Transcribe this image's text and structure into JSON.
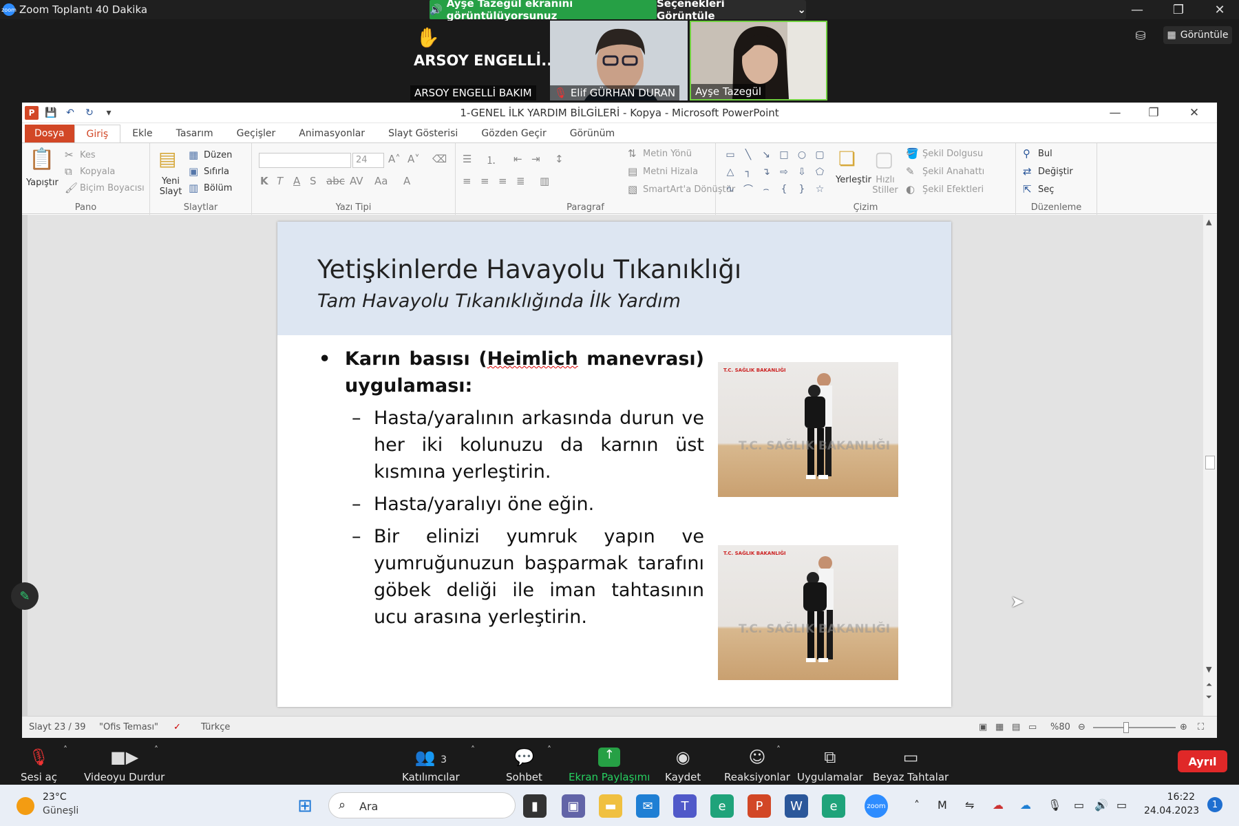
{
  "zoom": {
    "window_title": "Zoom Toplantı 40 Dakika",
    "share_banner": "Ayşe Tazegül ekranını görüntülüyorsunuz",
    "view_options": "Seçenekleri Görüntüle",
    "view_button": "Görüntüle",
    "participants": [
      {
        "name": "ARSOY ENGELLİ BAKIM",
        "display_big": "ARSOY  ENGELLİ..."
      },
      {
        "name": "Elif GÜRHAN DURAN"
      },
      {
        "name": "Ayşe Tazegül"
      }
    ],
    "controls": {
      "unmute": "Sesi aç",
      "stop_video": "Videoyu Durdur",
      "participants": "Katılımcılar",
      "participants_count": "3",
      "chat": "Sohbet",
      "share": "Ekran Paylaşımı",
      "record": "Kaydet",
      "reactions": "Reaksiyonlar",
      "apps": "Uygulamalar",
      "whiteboards": "Beyaz Tahtalar",
      "leave": "Ayrıl"
    },
    "share_color": "#26a045",
    "leave_color": "#e02828"
  },
  "ppt": {
    "title": "1-GENEL İLK YARDIM BİLGİLERİ - Kopya  -  Microsoft PowerPoint",
    "tabs": [
      "Dosya",
      "Giriş",
      "Ekle",
      "Tasarım",
      "Geçişler",
      "Animasyonlar",
      "Slayt Gösterisi",
      "Gözden Geçir",
      "Görünüm"
    ],
    "ribbon": {
      "pano": {
        "label": "Pano",
        "paste": "Yapıştır",
        "cut": "Kes",
        "copy": "Kopyala",
        "format_painter": "Biçim Boyacısı"
      },
      "slaytlar": {
        "label": "Slaytlar",
        "new_slide": "Yeni Slayt",
        "layout": "Düzen",
        "reset": "Sıfırla",
        "section": "Bölüm"
      },
      "yazi_tipi": {
        "label": "Yazı Tipi",
        "font_size": "24"
      },
      "paragraf": {
        "label": "Paragraf",
        "text_direction": "Metin Yönü",
        "align_text": "Metni Hizala",
        "smartart": "SmartArt'a Dönüştür"
      },
      "cizim": {
        "label": "Çizim",
        "arrange": "Yerleştir",
        "quick_styles": "Hızlı Stiller",
        "shape_fill": "Şekil Dolgusu",
        "shape_outline": "Şekil Anahattı",
        "shape_effects": "Şekil Efektleri"
      },
      "duzenleme": {
        "label": "Düzenleme",
        "find": "Bul",
        "replace": "Değiştir",
        "select": "Seç"
      }
    },
    "slide": {
      "title": "Yetişkinlerde Havayolu Tıkanıklığı",
      "subtitle": "Tam Havayolu Tıkanıklığında İlk Yardım",
      "bullet_pre": "Karın basısı (",
      "bullet_mid": "Heimlich",
      "bullet_post": " manevrası) uygulaması:",
      "subbullets": [
        "Hasta/yaralının arkasında durun ve her iki kolunuzu da karnın üst kısmına yerleştirin.",
        "Hasta/yaralıyı öne eğin.",
        "Bir elinizi yumruk yapın ve yumruğunuzun başparmak tarafını göbek deliği ile iman tahtasının ucu arasına yerleştirin."
      ],
      "image_logo": "T.C. SAĞLIK BAKANLIĞI",
      "image_watermark": "T.C. SAĞLIK BAKANLIĞI"
    },
    "status": {
      "slide": "Slayt 23 / 39",
      "theme": "\"Ofis Teması\"",
      "language": "Türkçe",
      "zoom": "%80"
    }
  },
  "taskbar": {
    "temperature": "23°C",
    "weather": "Güneşli",
    "search_placeholder": "Ara",
    "time": "16:22",
    "date": "24.04.2023",
    "notification_count": "1"
  }
}
